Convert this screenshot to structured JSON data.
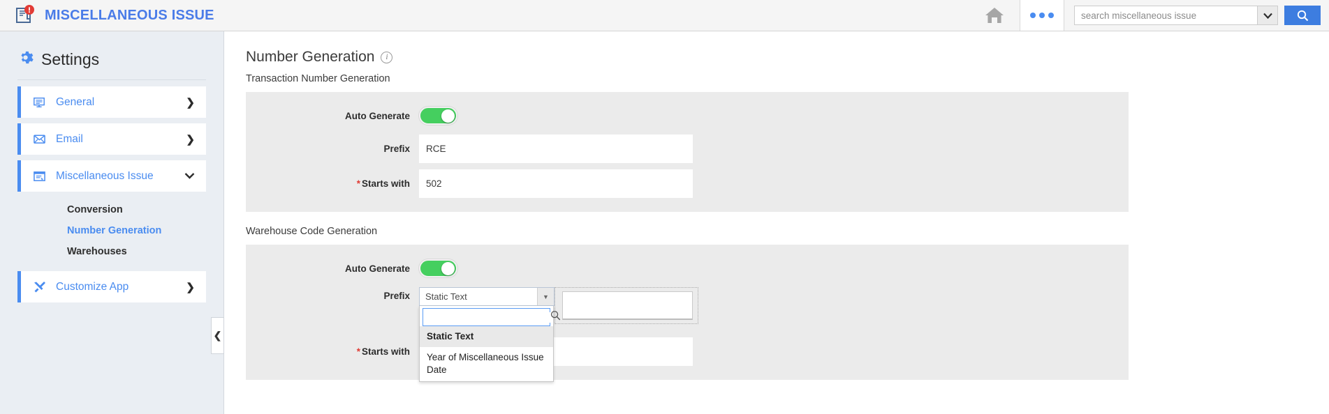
{
  "topbar": {
    "app_title": "MISCELLANEOUS ISSUE",
    "app_icon": "document-alert-icon",
    "badge": "!",
    "home_icon": "home-icon",
    "more_icon": "more-options-icon",
    "search_placeholder": "search miscellaneous issue",
    "search_value": "",
    "search_dropdown_icon": "chevron-down-icon",
    "search_button_icon": "search-icon",
    "accent_blue": "#3d7de0"
  },
  "sidebar": {
    "title": "Settings",
    "gear_icon": "gear-icon",
    "items": [
      {
        "label": "General",
        "icon": "monitor-icon",
        "chevron": "❯"
      },
      {
        "label": "Email",
        "icon": "envelope-icon",
        "chevron": "❯"
      },
      {
        "label": "Miscellaneous Issue",
        "icon": "window-list-icon",
        "chevron": "⌄"
      }
    ],
    "subitems": [
      {
        "label": "Conversion",
        "active": false
      },
      {
        "label": "Number Generation",
        "active": true
      },
      {
        "label": "Warehouses",
        "active": false
      }
    ],
    "customize": {
      "label": "Customize App",
      "icon": "tools-icon",
      "chevron": "❯"
    },
    "collapse_icon": "❮",
    "link_color": "#4a8cf0"
  },
  "main": {
    "page_title": "Number Generation",
    "info_icon": "info-icon",
    "info_glyph": "i",
    "sections": [
      {
        "heading": "Transaction Number Generation",
        "auto_generate_label": "Auto Generate",
        "auto_generate_on": true,
        "prefix_label": "Prefix",
        "prefix_value": "RCE",
        "starts_with_label": "Starts with",
        "starts_with_required": "*",
        "starts_with_value": "502"
      },
      {
        "heading": "Warehouse Code Generation",
        "auto_generate_label": "Auto Generate",
        "auto_generate_on": true,
        "prefix_label": "Prefix",
        "prefix_selected": "Static Text",
        "prefix_static_value": "",
        "starts_with_label": "Starts with",
        "starts_with_required": "*",
        "starts_with_value": ""
      }
    ],
    "dropdown": {
      "open": true,
      "search_value": "",
      "search_icon": "search-icon",
      "caret_icon": "caret-down-icon",
      "options": [
        {
          "label": "Static Text",
          "selected": true
        },
        {
          "label": "Year of Miscellaneous Issue Date",
          "selected": false
        }
      ]
    },
    "toggle_on_color": "#45cf5f"
  }
}
